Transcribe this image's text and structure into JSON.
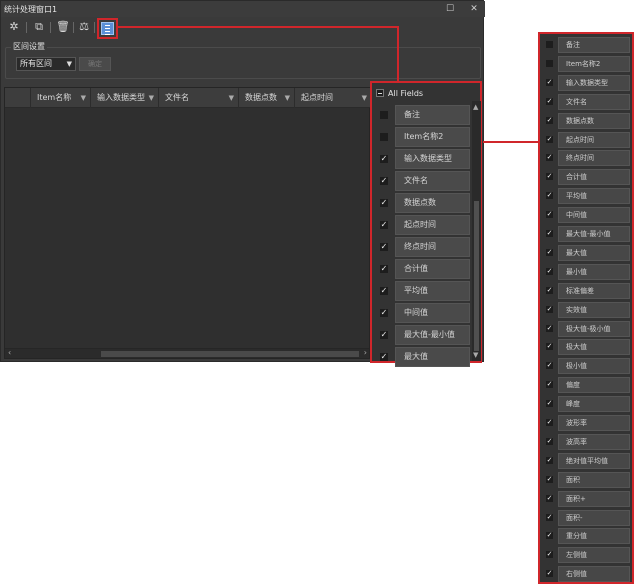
{
  "window": {
    "title": "统计处理窗口1",
    "maximize_glyph": "☐",
    "close_glyph": "✕"
  },
  "toolbar": {
    "icons": [
      "gear-icon",
      "export-icon",
      "trash-icon",
      "balance-icon",
      "field-list-icon"
    ]
  },
  "range": {
    "group_title": "区间设置",
    "selected": "所有区间",
    "button_label": "确定"
  },
  "grid": {
    "columns": [
      "Item名称",
      "输入数据类型",
      "文件名",
      "数据点数",
      "起点时间"
    ]
  },
  "popup": {
    "all_fields_label": "All Fields",
    "items": [
      {
        "label": "备注",
        "checked": false
      },
      {
        "label": "Item名称2",
        "checked": false
      },
      {
        "label": "输入数据类型",
        "checked": true
      },
      {
        "label": "文件名",
        "checked": true
      },
      {
        "label": "数据点数",
        "checked": true
      },
      {
        "label": "起点时间",
        "checked": true
      },
      {
        "label": "终点时间",
        "checked": true
      },
      {
        "label": "合计值",
        "checked": true
      },
      {
        "label": "平均值",
        "checked": true
      },
      {
        "label": "中间值",
        "checked": true
      },
      {
        "label": "最大值-最小值",
        "checked": true
      },
      {
        "label": "最大值",
        "checked": true
      }
    ]
  },
  "field_list": [
    {
      "label": "备注",
      "checked": false
    },
    {
      "label": "Item名称2",
      "checked": false
    },
    {
      "label": "输入数据类型",
      "checked": true
    },
    {
      "label": "文件名",
      "checked": true
    },
    {
      "label": "数据点数",
      "checked": true
    },
    {
      "label": "起点时间",
      "checked": true
    },
    {
      "label": "终点时间",
      "checked": true
    },
    {
      "label": "合计值",
      "checked": true
    },
    {
      "label": "平均值",
      "checked": true
    },
    {
      "label": "中间值",
      "checked": true
    },
    {
      "label": "最大值-最小值",
      "checked": true
    },
    {
      "label": "最大值",
      "checked": true
    },
    {
      "label": "最小值",
      "checked": true
    },
    {
      "label": "标准偏差",
      "checked": true
    },
    {
      "label": "实效值",
      "checked": true
    },
    {
      "label": "极大值-极小值",
      "checked": true
    },
    {
      "label": "极大值",
      "checked": true
    },
    {
      "label": "极小值",
      "checked": true
    },
    {
      "label": "偏度",
      "checked": true
    },
    {
      "label": "峰度",
      "checked": true
    },
    {
      "label": "波形率",
      "checked": true
    },
    {
      "label": "波高率",
      "checked": true
    },
    {
      "label": "绝对值平均值",
      "checked": true
    },
    {
      "label": "面积",
      "checked": true
    },
    {
      "label": "面积+",
      "checked": true
    },
    {
      "label": "面积-",
      "checked": true
    },
    {
      "label": "重分值",
      "checked": true
    },
    {
      "label": "左侧值",
      "checked": true
    },
    {
      "label": "右侧值",
      "checked": true
    }
  ],
  "colors": {
    "highlight": "#d0262b",
    "panel": "#3a3a3a",
    "item": "#4a4a4a"
  }
}
